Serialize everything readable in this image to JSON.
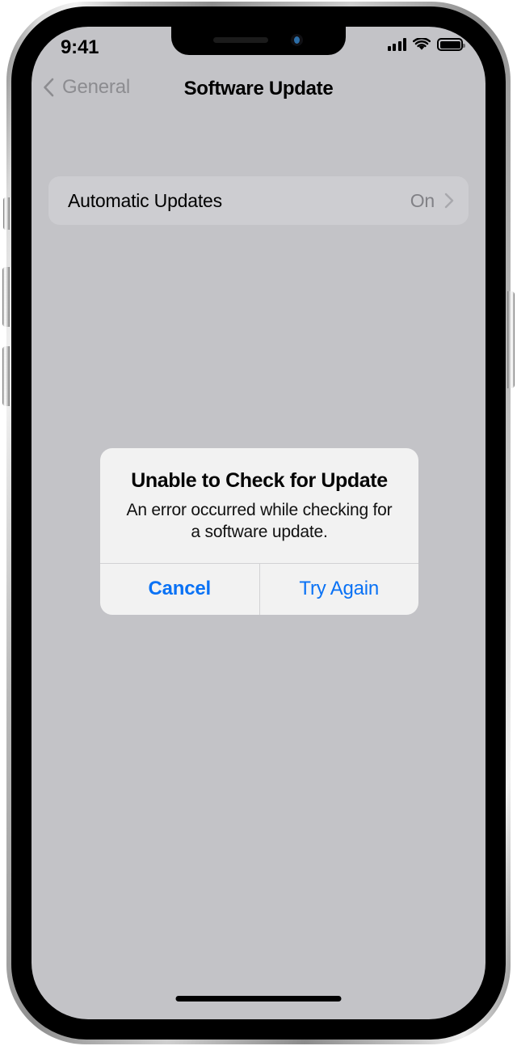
{
  "device": {
    "name": "iphone-frame",
    "notch": {
      "speaker": "earpiece-speaker",
      "camera": "front-camera"
    },
    "buttons": {
      "mute": "Ring/Silent switch",
      "volume_up": "Volume Up",
      "volume_down": "Volume Down",
      "power": "Side button"
    }
  },
  "status_bar": {
    "time": "9:41",
    "cellular_icon": "cellular-signal-icon",
    "cellular_bars": 4,
    "wifi_icon": "wifi-icon",
    "battery_icon": "battery-icon",
    "battery_full": true
  },
  "nav_bar": {
    "back_icon": "chevron-left-icon",
    "back_label": "General",
    "title": "Software Update"
  },
  "settings": {
    "rows": [
      {
        "label": "Automatic Updates",
        "value": "On",
        "chevron_icon": "chevron-right-icon"
      }
    ]
  },
  "alert": {
    "title": "Unable to Check for Update",
    "message": "An error occurred while checking for a software update.",
    "buttons": [
      {
        "label": "Cancel",
        "style": "primary"
      },
      {
        "label": "Try Again",
        "style": "default"
      }
    ]
  },
  "home_indicator": "home-indicator",
  "colors": {
    "screen_background": "#c3c3c7",
    "row_background": "#cdcdd1",
    "alert_background": "#f2f2f2",
    "accent_blue": "#0a72f5",
    "secondary_text": "#818186",
    "back_label": "#8c8c90"
  }
}
